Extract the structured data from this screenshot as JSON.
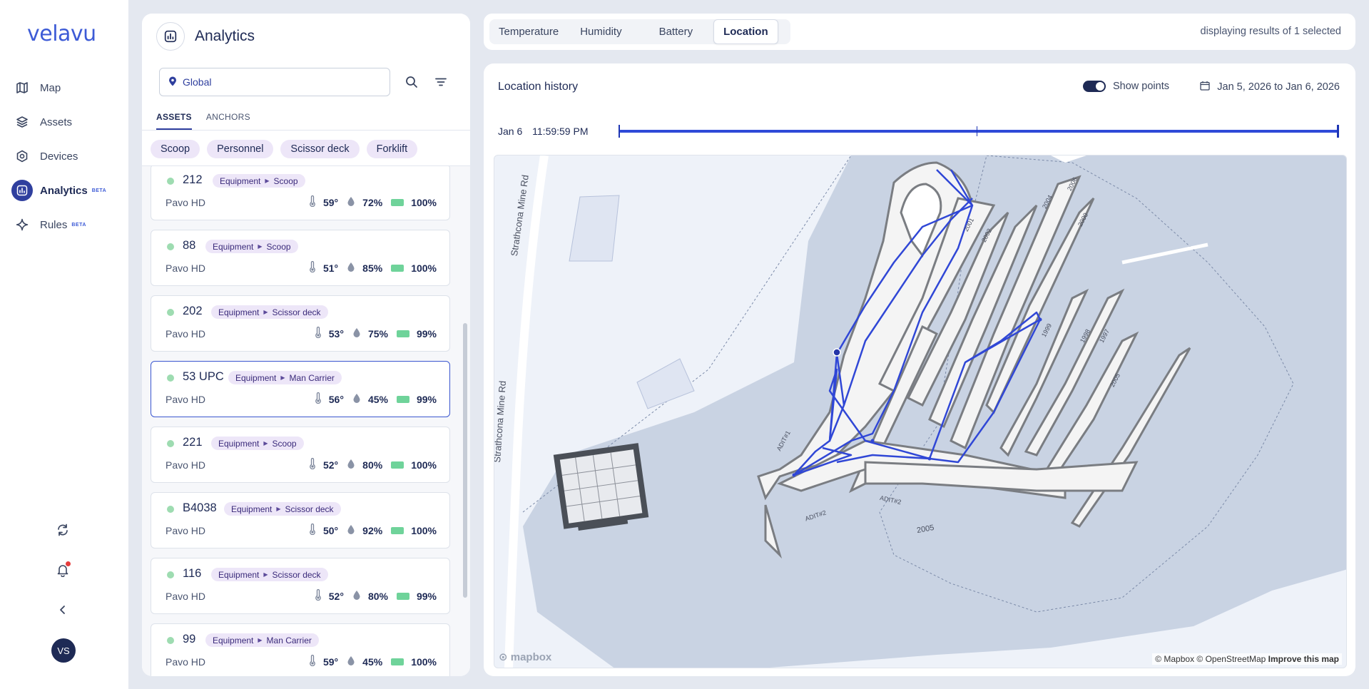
{
  "app": {
    "logo": "velavu"
  },
  "sidebar": {
    "items": [
      {
        "label": "Map",
        "icon": "map-icon",
        "beta": ""
      },
      {
        "label": "Assets",
        "icon": "layers-icon",
        "beta": ""
      },
      {
        "label": "Devices",
        "icon": "device-icon",
        "beta": ""
      },
      {
        "label": "Analytics",
        "icon": "analytics-icon",
        "beta": "BETA"
      },
      {
        "label": "Rules",
        "icon": "sparkle-icon",
        "beta": "BETA"
      }
    ],
    "avatar_initials": "VS"
  },
  "left_panel": {
    "title": "Analytics",
    "location_value": "Global",
    "subtabs": [
      "ASSETS",
      "ANCHORS"
    ],
    "chips": [
      "Scoop",
      "Personnel",
      "Scissor deck",
      "Forklift"
    ],
    "assets": [
      {
        "name": "212",
        "category": "Equipment",
        "type": "Scoop",
        "model": "Pavo HD",
        "temp": "59°",
        "humidity": "72%",
        "battery": "100%"
      },
      {
        "name": "88",
        "category": "Equipment",
        "type": "Scoop",
        "model": "Pavo HD",
        "temp": "51°",
        "humidity": "85%",
        "battery": "100%"
      },
      {
        "name": "202",
        "category": "Equipment",
        "type": "Scissor deck",
        "model": "Pavo HD",
        "temp": "53°",
        "humidity": "75%",
        "battery": "99%"
      },
      {
        "name": "53 UPC",
        "category": "Equipment",
        "type": "Man Carrier",
        "model": "Pavo HD",
        "temp": "56°",
        "humidity": "45%",
        "battery": "99%"
      },
      {
        "name": "221",
        "category": "Equipment",
        "type": "Scoop",
        "model": "Pavo HD",
        "temp": "52°",
        "humidity": "80%",
        "battery": "100%"
      },
      {
        "name": "B4038",
        "category": "Equipment",
        "type": "Scissor deck",
        "model": "Pavo HD",
        "temp": "50°",
        "humidity": "92%",
        "battery": "100%"
      },
      {
        "name": "116",
        "category": "Equipment",
        "type": "Scissor deck",
        "model": "Pavo HD",
        "temp": "52°",
        "humidity": "80%",
        "battery": "99%"
      },
      {
        "name": "99",
        "category": "Equipment",
        "type": "Man Carrier",
        "model": "Pavo HD",
        "temp": "59°",
        "humidity": "45%",
        "battery": "100%"
      }
    ]
  },
  "top_tabs": {
    "tabs": [
      "Temperature",
      "Humidity",
      "Battery",
      "Location"
    ],
    "active": "Location",
    "result_text": "displaying results of 1 selected"
  },
  "location_history": {
    "title": "Location history",
    "show_points_label": "Show points",
    "date_range": "Jan 5, 2026 to Jan 6, 2026",
    "timeline_date": "Jan 6",
    "timeline_time": "11:59:59 PM"
  },
  "map": {
    "road_labels": [
      "Strathcona Mine Rd",
      "Strathcona Mine Rd"
    ],
    "drift_labels": [
      "2004",
      "2006",
      "2001",
      "2002",
      "2000",
      "1999",
      "1998",
      "1997",
      "2005",
      "ADIT#1",
      "ADIT#2",
      "ADIT#2",
      "2005"
    ],
    "attribution": "© Mapbox © OpenStreetMap",
    "improve_link": "Improve this map",
    "mapbox_logo": "mapbox"
  },
  "colors": {
    "accent": "#2f3f9e",
    "path": "#3047d6",
    "tag_bg": "#ede6f8",
    "online": "#9edcb1",
    "battery": "#6fd39a"
  }
}
